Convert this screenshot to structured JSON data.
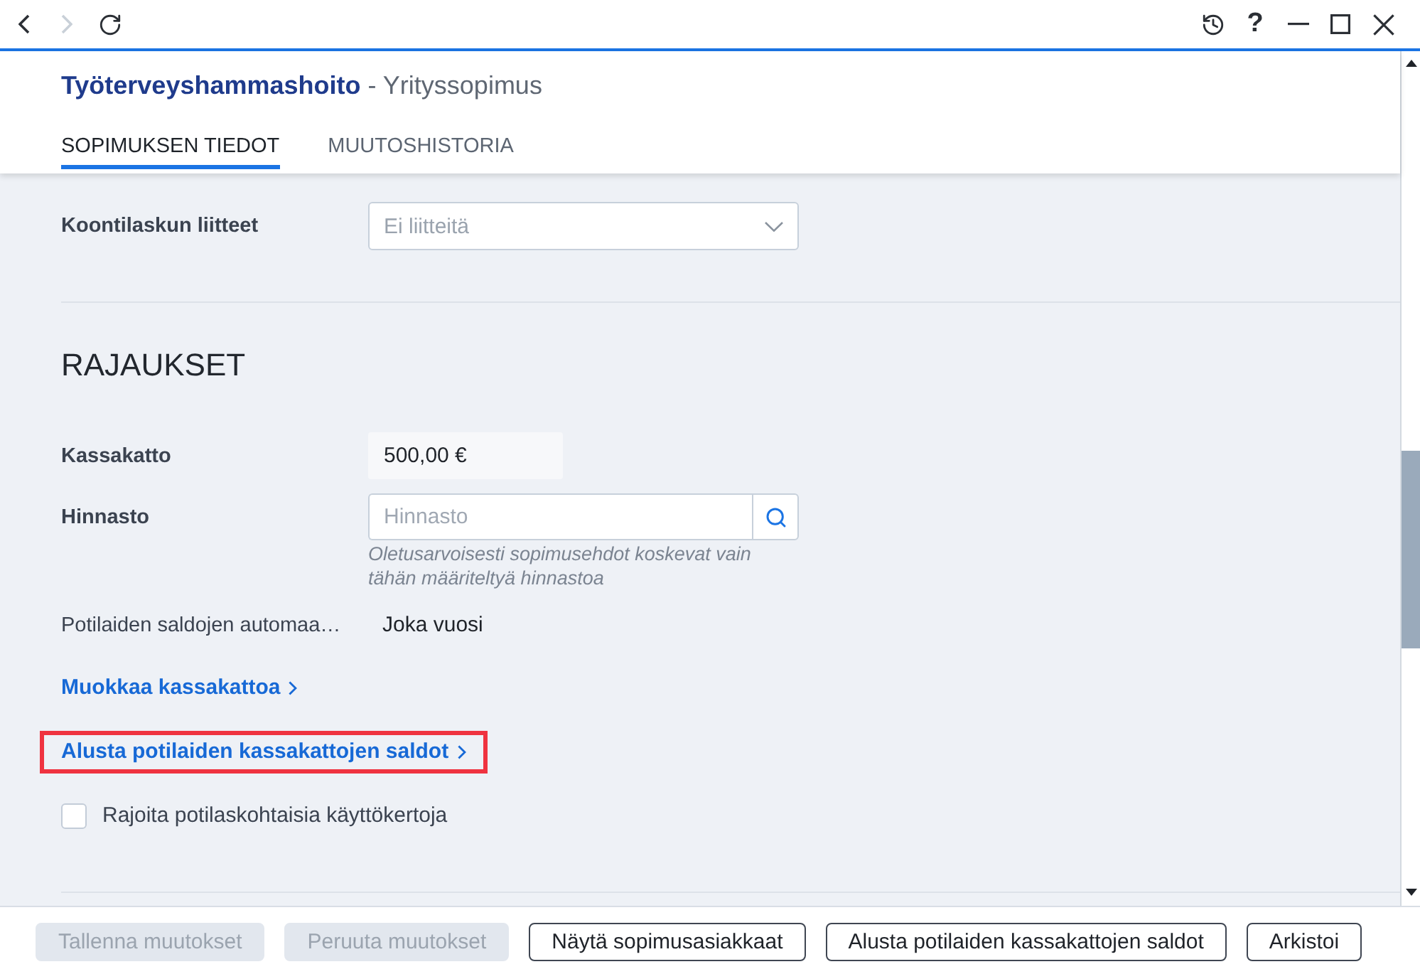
{
  "toolbar": {
    "nav_buttons": [
      {
        "kind": "back",
        "disabled": false
      },
      {
        "kind": "forward",
        "disabled": true
      },
      {
        "kind": "reload",
        "disabled": false
      }
    ],
    "help_label": "?"
  },
  "header": {
    "title": "**Työterveyshammashoito** - Yrityssopimus",
    "tabs": [
      {
        "label": "SOPIMUKSEN TIEDOT",
        "selected": true
      },
      {
        "label": "MUUTOSHISTORIA",
        "selected": false
      }
    ]
  },
  "attachments_field": {
    "kind": "select",
    "label": "Koontilaskun liitteet",
    "placeholder": "Ei liitteitä"
  },
  "limits": {
    "heading": "RAJAUKSET",
    "fields": [
      {
        "kind": "readonly",
        "label": "Kassakatto",
        "value": "500,00 €"
      },
      {
        "kind": "search",
        "label": "Hinnasto",
        "placeholder": "Hinnasto",
        "help": "Oletusarvoisesti sopimusehdot koskevat vain tähän määriteltyä hinnastoa"
      },
      {
        "kind": "text",
        "label": "Potilaiden saldojen automaa…",
        "value": "Joka vuosi"
      }
    ],
    "links": [
      {
        "label": "Muokkaa kassakattoa",
        "highlighted": false
      },
      {
        "label": "Alusta potilaiden kassakattojen saldot",
        "highlighted": true
      }
    ],
    "checkbox": {
      "label": "Rajoita potilaskohtaisia käyttökertoja",
      "checked": false
    }
  },
  "footer_buttons": [
    {
      "label": "Tallenna muutokset",
      "disabled": true
    },
    {
      "label": "Peruuta muutokset",
      "disabled": true
    },
    {
      "label": "Näytä sopimusasiakkaat",
      "disabled": false
    },
    {
      "label": "Alusta potilaiden kassakattojen saldot",
      "disabled": false
    },
    {
      "label": "Arkistoi",
      "disabled": false
    }
  ]
}
